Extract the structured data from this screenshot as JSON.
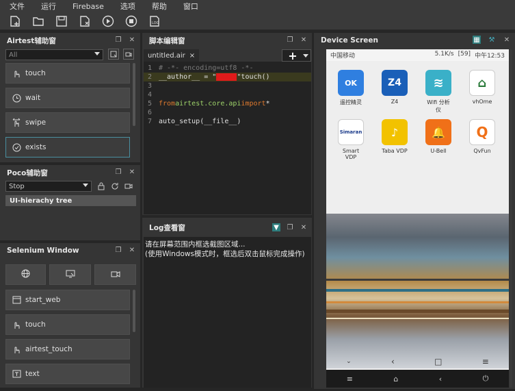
{
  "menu": [
    "文件",
    "运行",
    "Firebase",
    "选项",
    "帮助",
    "窗口"
  ],
  "airtest": {
    "title": "Airtest辅助窗",
    "filter_value": "All",
    "actions": [
      {
        "label": "touch",
        "icon": "touch-icon"
      },
      {
        "label": "wait",
        "icon": "clock-icon"
      },
      {
        "label": "swipe",
        "icon": "swipe-icon"
      },
      {
        "label": "exists",
        "icon": "check-icon"
      }
    ]
  },
  "poco": {
    "title": "Poco辅助窗",
    "mode_value": "Stop",
    "tree_item": "UI-hierachy tree"
  },
  "selenium": {
    "title": "Selenium Window",
    "actions": [
      {
        "label": "start_web",
        "icon": "browser-icon"
      },
      {
        "label": "touch",
        "icon": "touch-icon"
      },
      {
        "label": "airtest_touch",
        "icon": "touch-icon"
      },
      {
        "label": "text",
        "icon": "text-icon"
      }
    ]
  },
  "editor": {
    "title": "脚本编辑窗",
    "tab_label": "untitled.air",
    "tab_close": "×",
    "add_label": "+",
    "lines": [
      {
        "n": "1",
        "text": "# -*- encoding=utf8 -*-"
      },
      {
        "n": "2",
        "pre": "__author__ = \"",
        "redacted": "xxxxx",
        "post": "\"touch()"
      },
      {
        "n": "3",
        "text": ""
      },
      {
        "n": "4",
        "text": ""
      },
      {
        "n": "5",
        "kw1": "from",
        "mod": " airtest.core.api ",
        "kw2": "import",
        "rest": " *"
      },
      {
        "n": "6",
        "text": ""
      },
      {
        "n": "7",
        "text": "auto_setup(__file__)"
      }
    ]
  },
  "log": {
    "title": "Log查看窗",
    "lines": [
      "请在屏幕范围内框选截图区域...",
      "(使用Windows模式时，框选后双击鼠标完成操作)"
    ]
  },
  "device": {
    "title": "Device Screen",
    "status_left": "中国移动",
    "status_speed": "5.1K/s",
    "status_battery": "[59]",
    "status_time": "中午12:53",
    "apps": [
      {
        "label": "遥控精灵",
        "glyph": "OK",
        "color": "#2f7fe0"
      },
      {
        "label": "Z4",
        "glyph": "Z4",
        "color": "#1a5fb8"
      },
      {
        "label": "Wifi 分析仪",
        "glyph": "≋",
        "color": "#3ab0c8"
      },
      {
        "label": "vhOme",
        "glyph": "⌂",
        "color": "#ffffff"
      },
      {
        "label": "Smart VDP",
        "glyph": "Simaran",
        "color": "#ffffff"
      },
      {
        "label": "Taba VDP",
        "glyph": "♪",
        "color": "#f2c200"
      },
      {
        "label": "U-Bell",
        "glyph": "🔔",
        "color": "#f07018"
      },
      {
        "label": "QvFun",
        "glyph": "Q",
        "color": "#ffffff"
      }
    ]
  }
}
